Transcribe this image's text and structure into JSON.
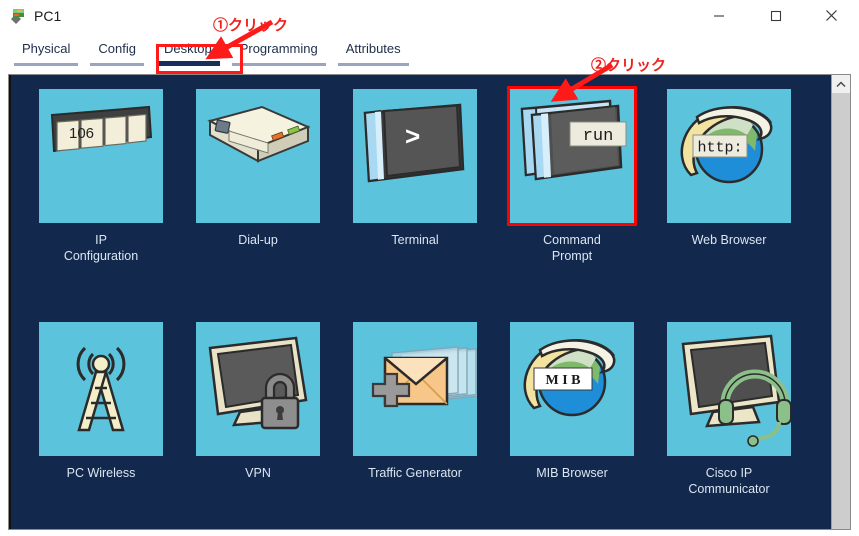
{
  "window": {
    "title": "PC1",
    "icon": "packet-tracer-device-icon",
    "controls": {
      "minimize": "—",
      "maximize": "□",
      "close": "✕"
    }
  },
  "tabs": [
    {
      "label": "Physical",
      "selected": false
    },
    {
      "label": "Config",
      "selected": false
    },
    {
      "label": "Desktop",
      "selected": true
    },
    {
      "label": "Programming",
      "selected": false
    },
    {
      "label": "Attributes",
      "selected": false
    }
  ],
  "desktop": {
    "background_color": "#12284c",
    "tile_color": "#5bc3dc",
    "items": [
      {
        "label": "IP\nConfiguration",
        "icon": "ip-configuration-icon",
        "badge": "106",
        "highlighted": false
      },
      {
        "label": "Dial-up",
        "icon": "dial-up-modem-icon",
        "badge": "",
        "highlighted": false
      },
      {
        "label": "Terminal",
        "icon": "terminal-icon",
        "badge": ">",
        "highlighted": false
      },
      {
        "label": "Command\nPrompt",
        "icon": "command-prompt-icon",
        "badge": "run",
        "highlighted": true
      },
      {
        "label": "Web Browser",
        "icon": "web-browser-icon",
        "badge": "http:",
        "highlighted": false
      },
      {
        "label": "PC Wireless",
        "icon": "pc-wireless-antenna-icon",
        "badge": "",
        "highlighted": false
      },
      {
        "label": "VPN",
        "icon": "vpn-lock-icon",
        "badge": "",
        "highlighted": false
      },
      {
        "label": "Traffic Generator",
        "icon": "traffic-generator-envelope-icon",
        "badge": "",
        "highlighted": false
      },
      {
        "label": "MIB Browser",
        "icon": "mib-browser-icon",
        "badge": "M I B",
        "highlighted": false
      },
      {
        "label": "Cisco IP Communicator",
        "icon": "cisco-ip-communicator-icon",
        "badge": "",
        "highlighted": false
      }
    ]
  },
  "scrollbar": {
    "up_arrow": "scroll-up-arrow-icon"
  },
  "annotations": [
    {
      "text": "①クリック",
      "color": "#f2201c",
      "target": "Desktop tab"
    },
    {
      "text": "②クリック",
      "color": "#f2201c",
      "target": "Command Prompt icon"
    }
  ]
}
